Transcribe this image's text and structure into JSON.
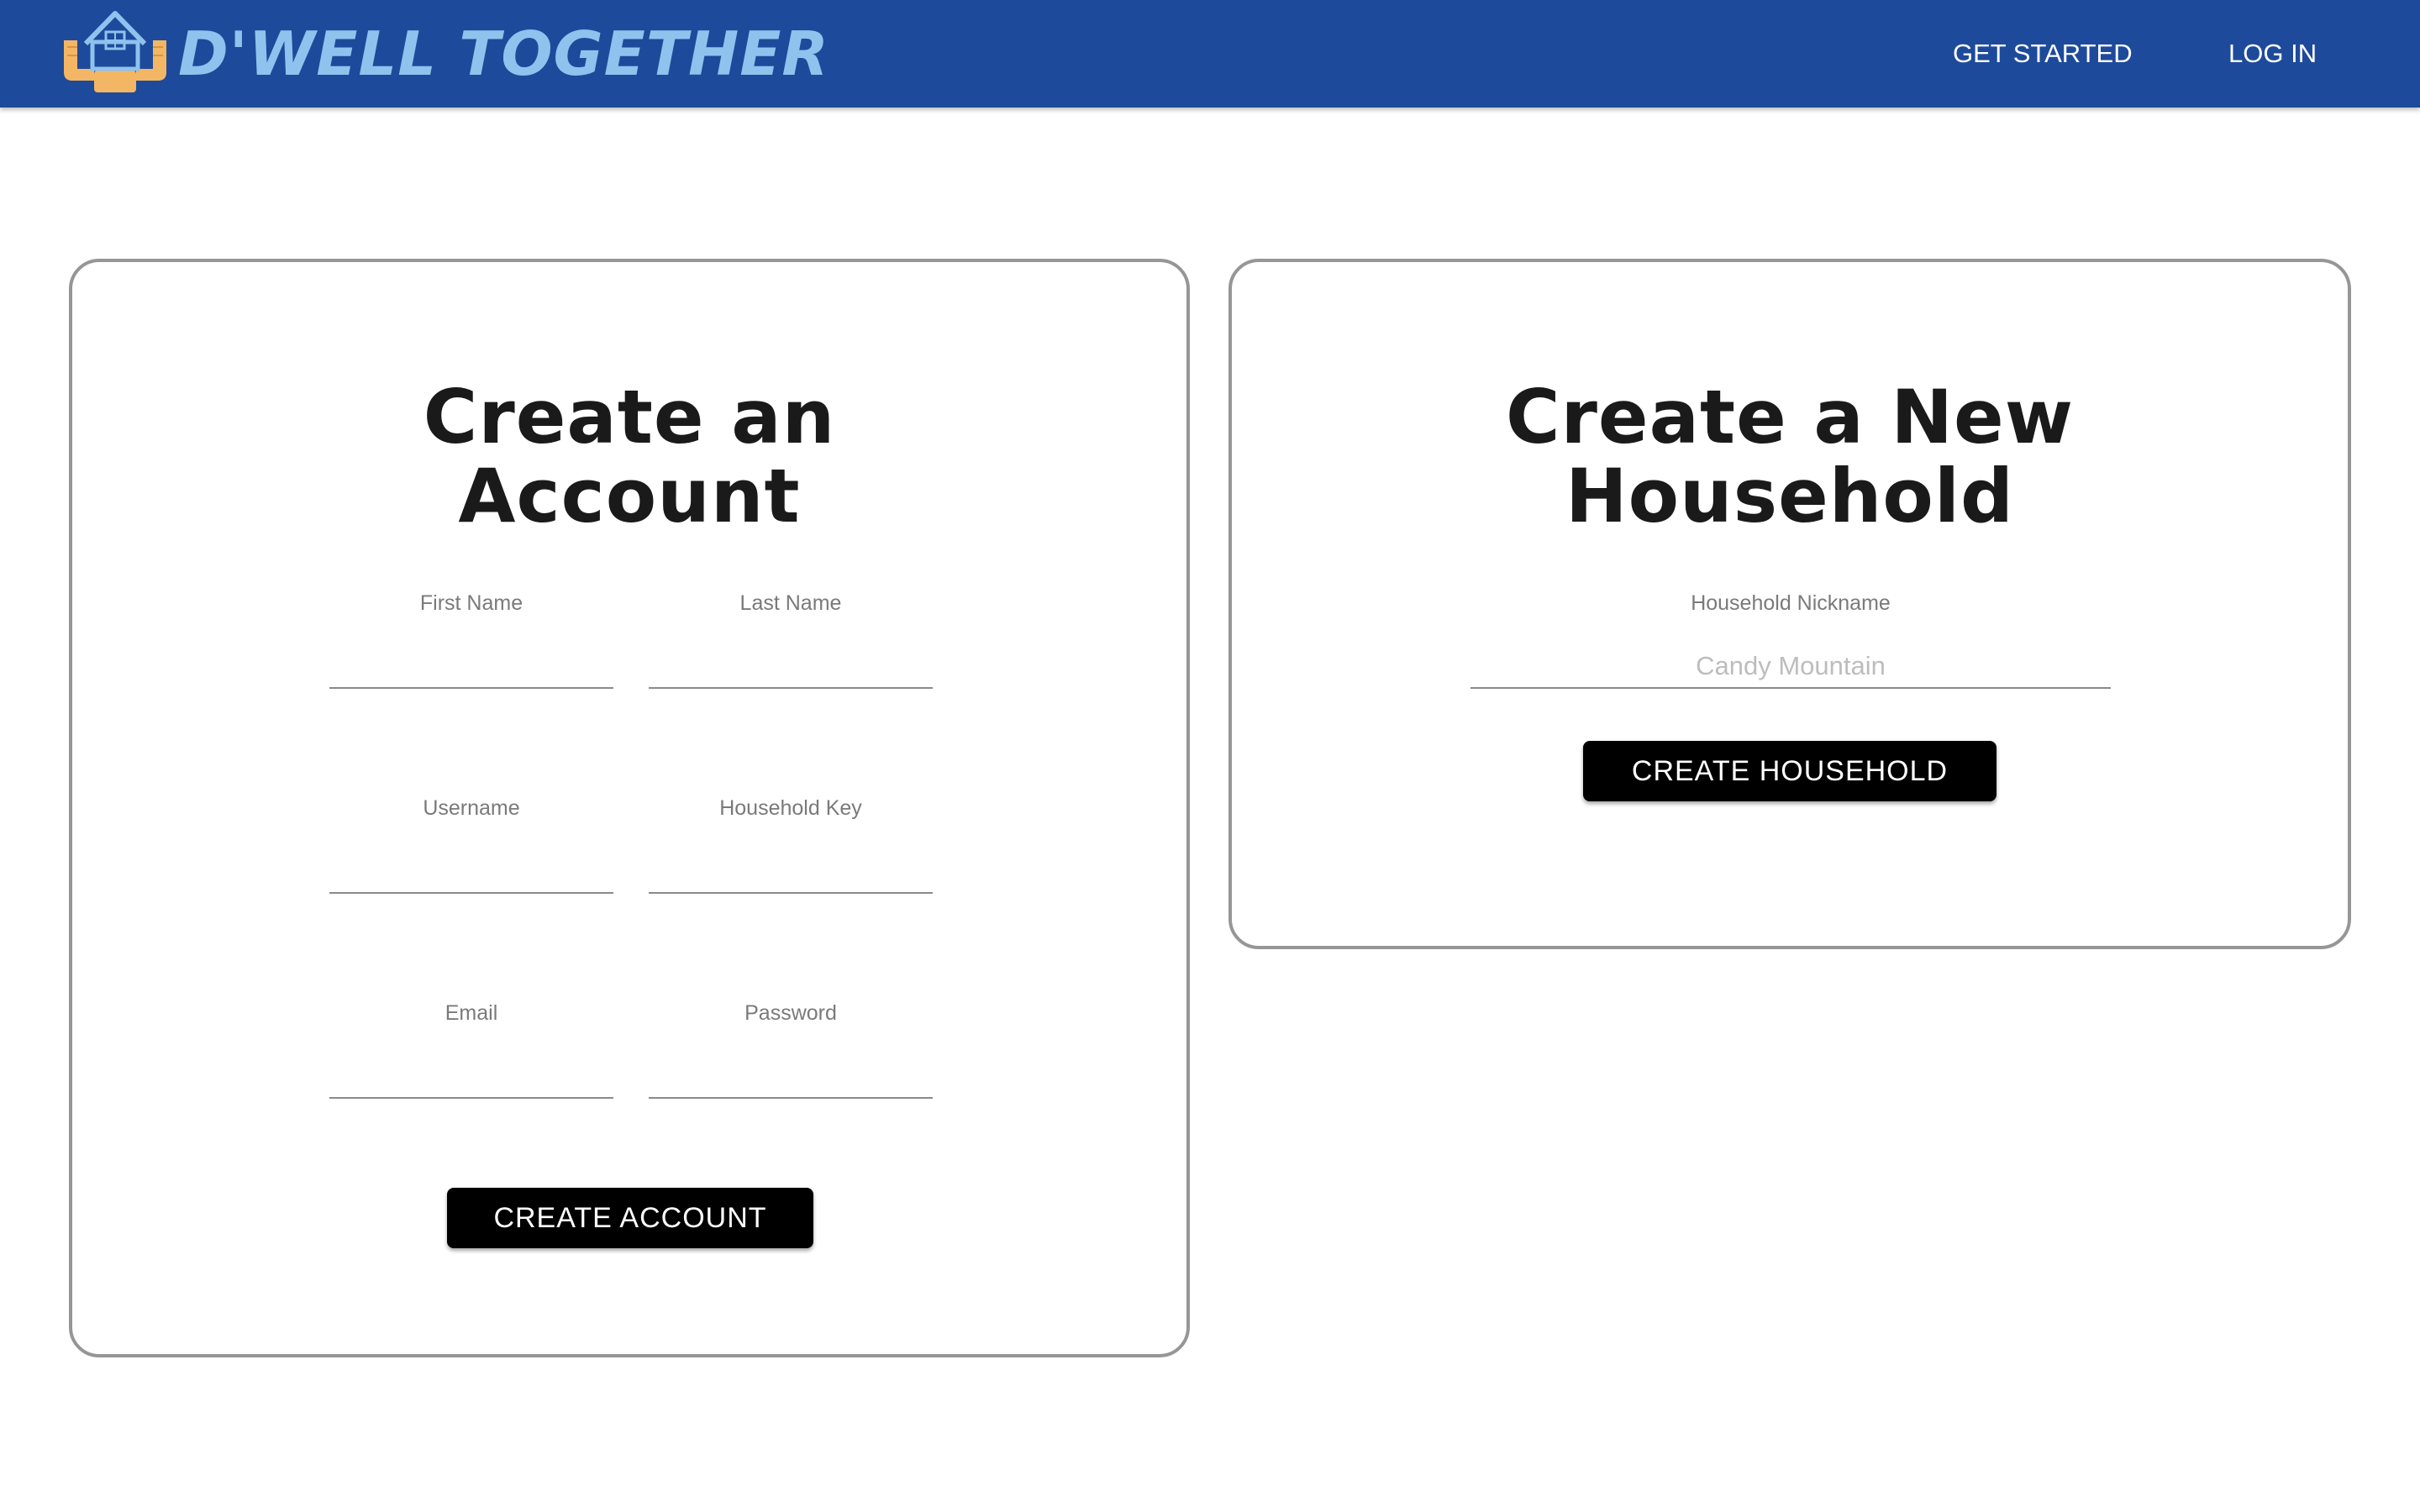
{
  "header": {
    "brand": "D'WELL TOGETHER",
    "logo_icon": "house-hands-icon",
    "nav": {
      "get_started": "GET STARTED",
      "log_in": "LOG IN"
    }
  },
  "colors": {
    "navbar": "#1e4a9b",
    "brand_text": "#8fc3ee",
    "logo_hands": "#f3b664",
    "button": "#000000",
    "card_border": "#969696"
  },
  "account_form": {
    "title_line1": "Create an",
    "title_line2": "Account",
    "fields": {
      "first_name": {
        "label": "First Name",
        "value": ""
      },
      "last_name": {
        "label": "Last Name",
        "value": ""
      },
      "username": {
        "label": "Username",
        "value": ""
      },
      "household_key": {
        "label": "Household Key",
        "value": ""
      },
      "email": {
        "label": "Email",
        "value": ""
      },
      "password": {
        "label": "Password",
        "value": ""
      }
    },
    "submit_label": "CREATE ACCOUNT"
  },
  "household_form": {
    "title_line1": "Create a New",
    "title_line2": "Household",
    "fields": {
      "nickname": {
        "label": "Household Nickname",
        "placeholder": "Candy Mountain",
        "value": ""
      }
    },
    "submit_label": "CREATE HOUSEHOLD"
  }
}
